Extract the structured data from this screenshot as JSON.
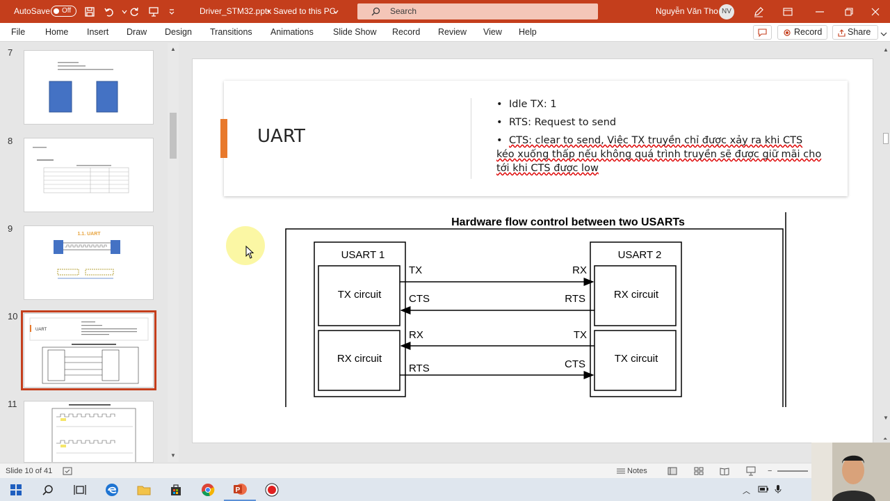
{
  "titlebar": {
    "autosave_label": "AutoSave",
    "autosave_state": "Off",
    "filename": "Driver_STM32.pptx",
    "saved_status": "Saved to this PC",
    "search_placeholder": "Search",
    "user_name": "Nguyễn Văn Tho",
    "user_initials": "NV"
  },
  "menu": {
    "items": [
      "File",
      "Home",
      "Insert",
      "Draw",
      "Design",
      "Transitions",
      "Animations",
      "Slide Show",
      "Record",
      "Review",
      "View",
      "Help"
    ],
    "record_label": "Record",
    "share_label": "Share"
  },
  "thumbnails": {
    "numbers": [
      "7",
      "8",
      "9",
      "10",
      "11"
    ],
    "selected": "10",
    "slide9_title": "1.1. UART",
    "slide10_title": "UART"
  },
  "slide": {
    "title": "UART",
    "bullets": [
      "Idle TX: 1",
      "RTS: Request to send",
      "CTS: clear to send, Việc TX truyền chỉ được xảy ra khi CTS kéo xuống thấp nếu không quá trình truyền sẽ được giữ mãi cho tới khi CTS được low"
    ],
    "accent_color": "#e8792c",
    "diagram": {
      "title": "Hardware flow control between two USARTs",
      "usart1": "USART 1",
      "usart2": "USART 2",
      "tx_circuit": "TX circuit",
      "rx_circuit": "RX circuit",
      "signals_left": [
        "TX",
        "CTS",
        "RX",
        "RTS"
      ],
      "signals_right": [
        "RX",
        "RTS",
        "TX",
        "CTS"
      ]
    }
  },
  "status": {
    "slide_info": "Slide 10 of 41",
    "notes_label": "Notes"
  },
  "colors": {
    "brand": "#c43e1c",
    "selection": "#c43e1c"
  }
}
